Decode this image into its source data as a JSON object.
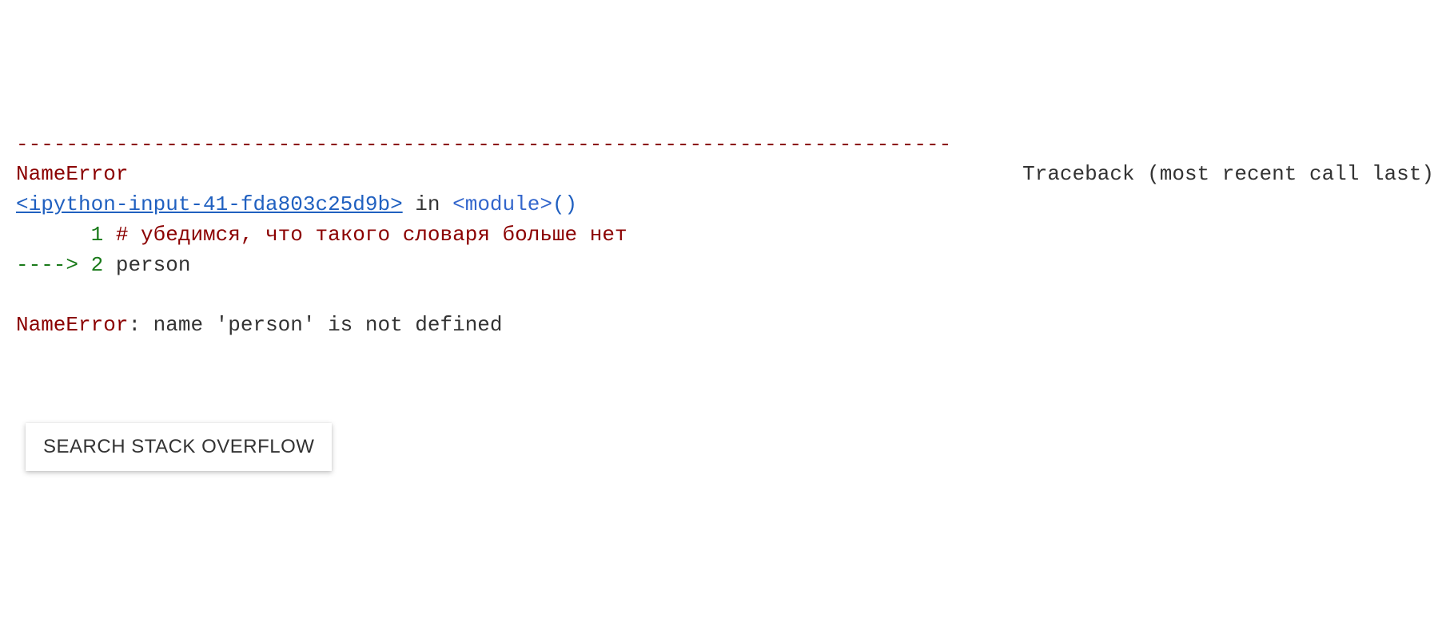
{
  "traceback": {
    "separator": "---------------------------------------------------------------------------",
    "error_name": "NameError",
    "traceback_label": "Traceback (most recent call last)",
    "source_link": "<ipython-input-41-fda803c25d9b>",
    "in_text": " in ",
    "module_text": "<module>",
    "parens": "()",
    "line1": {
      "prefix": "      ",
      "lineno": "1",
      "space": " ",
      "comment": "# убедимся, что такого словаря больше нет"
    },
    "line2": {
      "arrow": "----> ",
      "lineno": "2",
      "space": " ",
      "code": "person"
    },
    "final_error_name": "NameError",
    "final_error_msg": ": name 'person' is not defined"
  },
  "button": {
    "label": "SEARCH STACK OVERFLOW"
  }
}
